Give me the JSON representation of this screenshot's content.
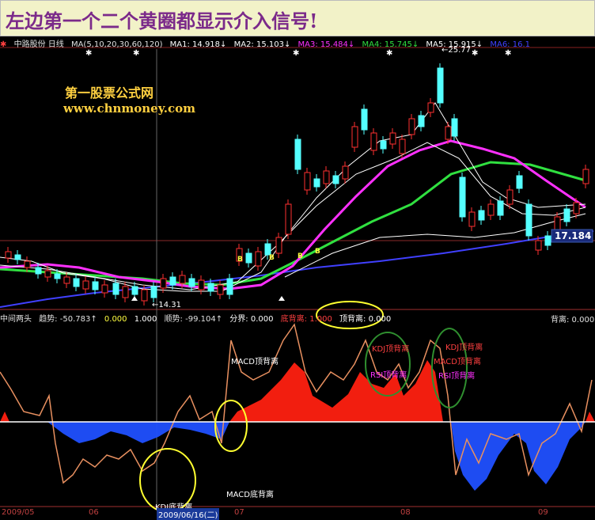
{
  "banner": {
    "title": "左边第一个二个黄圈都显示介入信号!"
  },
  "upper_header": {
    "stock": "中路股份 日线",
    "ma_def": "MA(5,10,20,30,60,120)",
    "ma1": "MA1: 14.918↓",
    "ma2": "MA2: 15.103↓",
    "ma3": "MA3: 15.484↓",
    "ma4": "MA4: 15.745↓",
    "ma5": "MA5: 15.915↓",
    "ma6": "MA6: 16.1"
  },
  "watermark": {
    "name": "第一股票公式网",
    "url": "www.chnmoney.com"
  },
  "price_labels": {
    "high": "25.77",
    "low": "14.31",
    "current": "17.184"
  },
  "lower_header": {
    "indicator": "中间两头",
    "trend": "趋势: -50.783↑",
    "v1": "0.000",
    "v2": "1.000",
    "shunshi": "顺势: -99.104↑",
    "fenjie": "分界: 0.000",
    "dibeili": "底背离: 1.000",
    "dingbeili": "顶背离: 0.000",
    "beili": "背离: 0.000"
  },
  "annotations": {
    "kdj_top_1": "KDJ顶背离",
    "rsi_top_1": "RSI顶背离",
    "kdj_top_2": "KDJ顶背离",
    "macd_top_2": "MACD顶背离",
    "rsi_top_2": "RSI顶背离",
    "macd_top_1": "MACD顶背离",
    "kdj_bottom": "KDJ底背离",
    "macd_bottom": "MACD底背离"
  },
  "xaxis": {
    "labels": [
      "2009/05",
      "06",
      "2009/06/16(二)",
      "07",
      "08",
      "09"
    ]
  },
  "colors": {
    "banner_bg": "#f2f2c8",
    "banner_text": "#7b2a8a",
    "up_candle": "#ff3030",
    "down_candle": "#54ffff",
    "ma_white": "#ffffff",
    "ma_yellow": "#ffff40",
    "ma_magenta": "#ff30ff",
    "ma_green": "#30e040",
    "ma_blue": "#4040ff",
    "area_red": "#ff2010",
    "area_blue": "#2050ff",
    "osc_line": "#e89060",
    "circle": "#ffff30",
    "circle_green": "#30a030"
  }
}
